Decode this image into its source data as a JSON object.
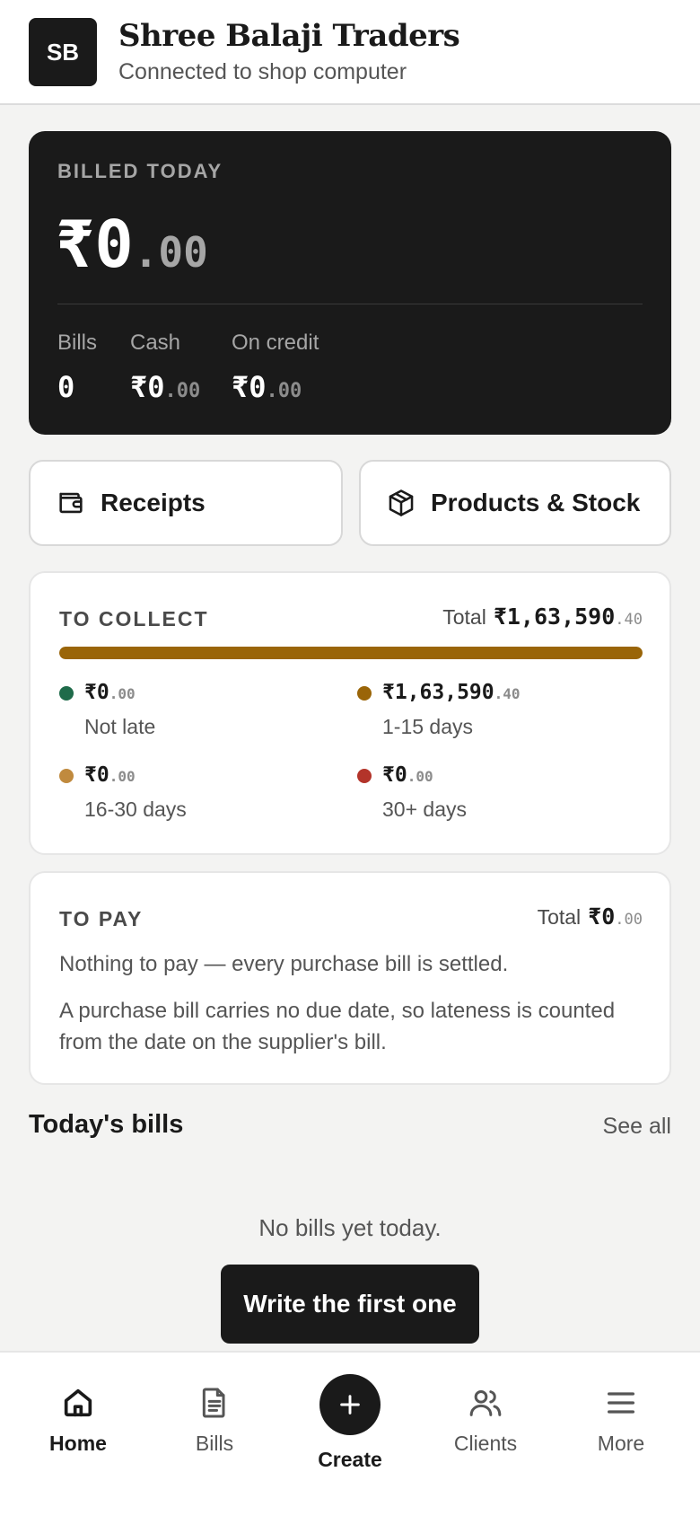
{
  "header": {
    "avatar_initials": "SB",
    "shop_name": "Shree Balaji Traders",
    "status": "Connected to shop computer"
  },
  "billed_today": {
    "label": "BILLED TODAY",
    "amount_main": "₹0",
    "amount_dec": ".00",
    "stats": [
      {
        "label": "Bills",
        "value_main": "0",
        "value_dec": ""
      },
      {
        "label": "Cash",
        "value_main": "₹0",
        "value_dec": ".00"
      },
      {
        "label": "On credit",
        "value_main": "₹0",
        "value_dec": ".00"
      }
    ]
  },
  "quick_actions": {
    "receipts_label": "Receipts",
    "products_label": "Products & Stock"
  },
  "to_collect": {
    "title": "TO COLLECT",
    "total_label": "Total",
    "total_main": "₹1,63,590",
    "total_dec": ".40",
    "progress_fraction": 1.0,
    "buckets": [
      {
        "amount_main": "₹0",
        "amount_dec": ".00",
        "label": "Not late",
        "color": "#1f6b4a"
      },
      {
        "amount_main": "₹1,63,590",
        "amount_dec": ".40",
        "label": "1-15 days",
        "color": "#9a6508"
      },
      {
        "amount_main": "₹0",
        "amount_dec": ".00",
        "label": "16-30 days",
        "color": "#c08a3e"
      },
      {
        "amount_main": "₹0",
        "amount_dec": ".00",
        "label": "30+ days",
        "color": "#b3342a"
      }
    ]
  },
  "to_pay": {
    "title": "TO PAY",
    "total_label": "Total",
    "total_main": "₹0",
    "total_dec": ".00",
    "message": "Nothing to pay — every purchase bill is settled.",
    "note": "A purchase bill carries no due date, so lateness is counted from the date on the supplier's bill."
  },
  "todays_bills": {
    "title": "Today's bills",
    "see_all": "See all",
    "empty_message": "No bills yet today.",
    "cta": "Write the first one"
  },
  "nav": {
    "home": "Home",
    "bills": "Bills",
    "create": "Create",
    "clients": "Clients",
    "more": "More"
  }
}
